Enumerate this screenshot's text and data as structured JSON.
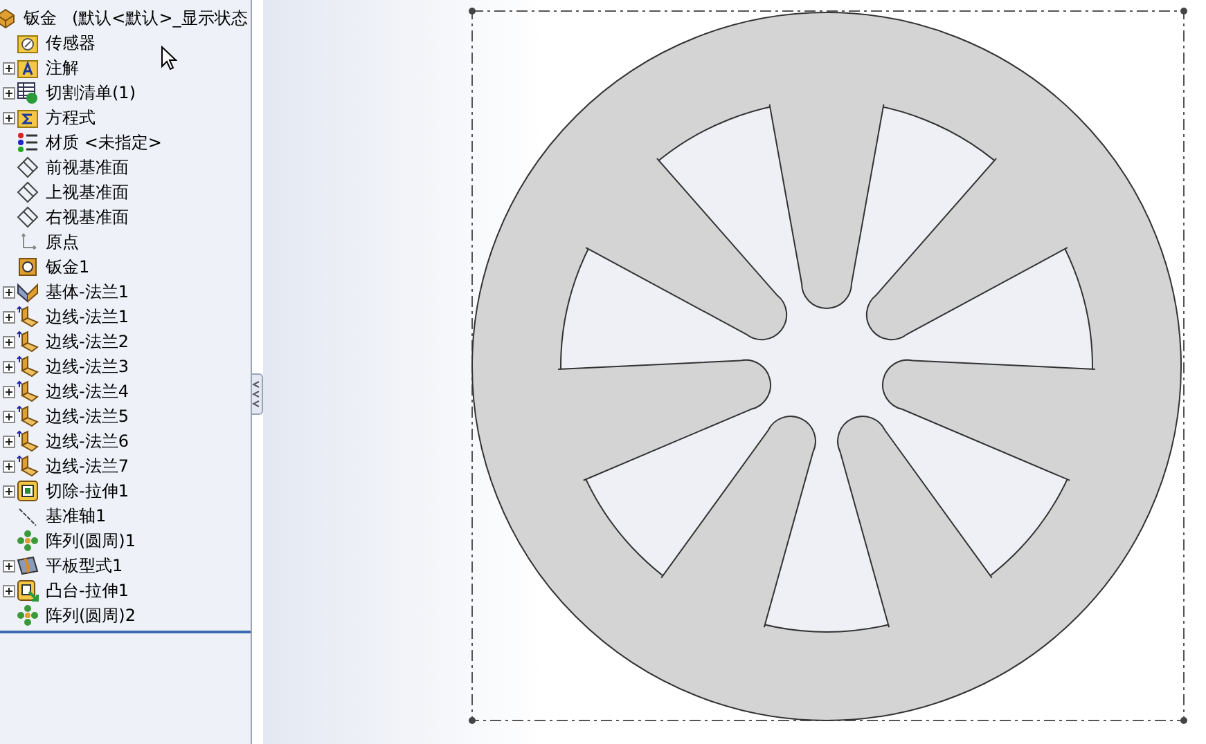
{
  "feature_tree": {
    "root": {
      "label": "钣金",
      "config": "(默认<默认>_显示状态"
    },
    "items": [
      {
        "label": "传感器",
        "kind": "sensor",
        "has_children": false
      },
      {
        "label": "注解",
        "kind": "annotation",
        "has_children": true
      },
      {
        "label": "切割清单(1)",
        "kind": "cutlist",
        "has_children": true
      },
      {
        "label": "方程式",
        "kind": "equation",
        "has_children": true
      },
      {
        "label": "材质 <未指定>",
        "kind": "material",
        "has_children": false
      },
      {
        "label": "前视基准面",
        "kind": "plane",
        "has_children": false
      },
      {
        "label": "上视基准面",
        "kind": "plane",
        "has_children": false
      },
      {
        "label": "右视基准面",
        "kind": "plane",
        "has_children": false
      },
      {
        "label": "原点",
        "kind": "origin",
        "has_children": false
      },
      {
        "label": "钣金1",
        "kind": "sheetmetal",
        "has_children": false
      },
      {
        "label": "基体-法兰1",
        "kind": "baseflange",
        "has_children": true
      },
      {
        "label": "边线-法兰1",
        "kind": "edgeflange",
        "has_children": true
      },
      {
        "label": "边线-法兰2",
        "kind": "edgeflange",
        "has_children": true
      },
      {
        "label": "边线-法兰3",
        "kind": "edgeflange",
        "has_children": true
      },
      {
        "label": "边线-法兰4",
        "kind": "edgeflange",
        "has_children": true
      },
      {
        "label": "边线-法兰5",
        "kind": "edgeflange",
        "has_children": true
      },
      {
        "label": "边线-法兰6",
        "kind": "edgeflange",
        "has_children": true
      },
      {
        "label": "边线-法兰7",
        "kind": "edgeflange",
        "has_children": true
      },
      {
        "label": "切除-拉伸1",
        "kind": "cut",
        "has_children": true
      },
      {
        "label": "基准轴1",
        "kind": "axis",
        "has_children": false
      },
      {
        "label": "阵列(圆周)1",
        "kind": "pattern",
        "has_children": false
      },
      {
        "label": "平板型式1",
        "kind": "flat",
        "has_children": true
      },
      {
        "label": "凸台-拉伸1",
        "kind": "boss",
        "has_children": true
      },
      {
        "label": "阵列(圆周)2",
        "kind": "pattern",
        "has_children": false
      }
    ]
  }
}
